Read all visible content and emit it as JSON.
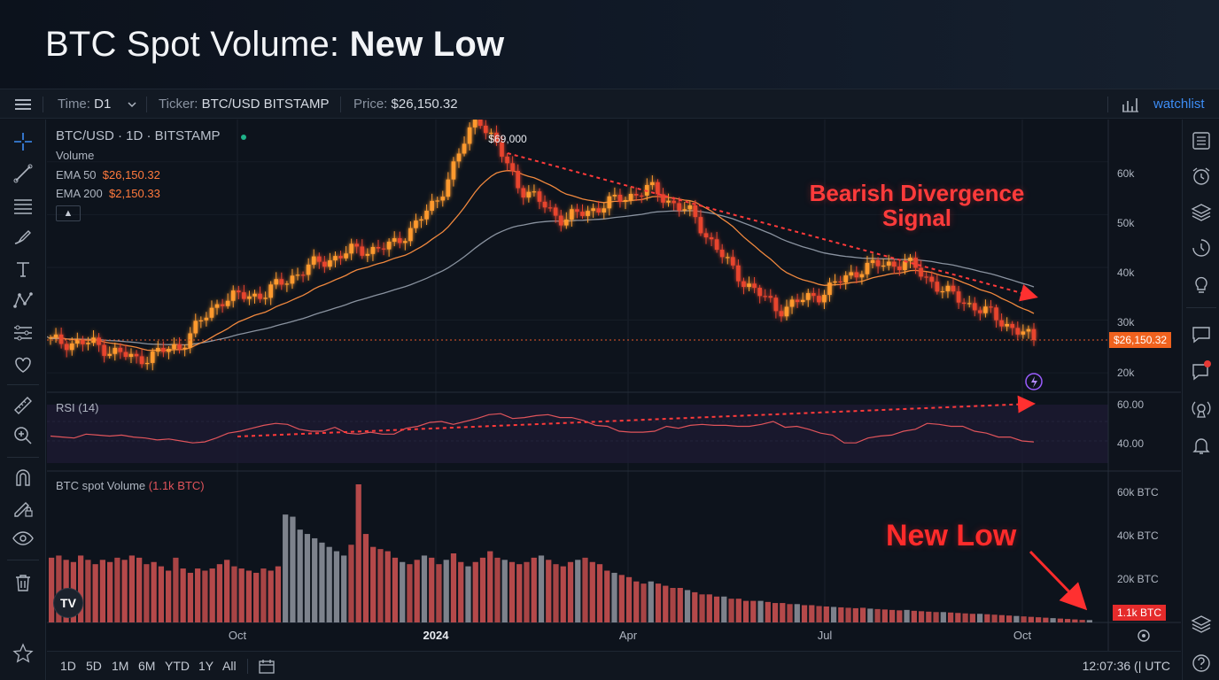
{
  "headline": {
    "prefix": "BTC Spot Volume: ",
    "emph": "New Low"
  },
  "toolbar": {
    "time_label": "Time:",
    "time_value": "D1",
    "ticker_label": "Ticker:",
    "ticker_value": "BTC/USD BITSTAMP",
    "price_label": "Price:",
    "price_value": "$26,150.32",
    "watchlist": "watchlist"
  },
  "legend": {
    "symbol": "BTC/USD · 1D · BITSTAMP",
    "volume": "Volume",
    "ema50_label": "EMA 50",
    "ema50_value": "$26,150.32",
    "ema200_label": "EMA 200",
    "ema200_value": "$2,150.33",
    "rsi_label": "RSI (14)",
    "vol_label": "BTC spot Volume",
    "vol_value": "(1.1k BTC)"
  },
  "annotations": {
    "peak_label": "$69,000",
    "divergence_line1": "Bearish Divergence",
    "divergence_line2": "Signal",
    "new_low": "New Low"
  },
  "badges": {
    "price": "$26,150.32",
    "volume": "1.1k BTC"
  },
  "bottombar": {
    "ranges": [
      "1D",
      "5D",
      "1M",
      "6M",
      "YTD",
      "1Y",
      "All"
    ],
    "clock": "12:07:36 (| UTC"
  },
  "colors": {
    "up": "#ff9a2e",
    "down": "#e8442e",
    "ema50": "#f0883e",
    "ema200": "#8a93a0",
    "accent": "#3d8df5",
    "alert": "#ff2b2b"
  },
  "icons": {
    "left": [
      "crosshair-icon",
      "trend-line-icon",
      "fib-retracement-icon",
      "brush-icon",
      "text-icon",
      "pattern-icon",
      "measure-lines-icon",
      "heart-icon",
      "ruler-icon",
      "zoom-in-icon",
      "magnet-icon",
      "lock-drawing-icon",
      "eye-icon",
      "trash-icon",
      "star-icon"
    ],
    "right": [
      "list-icon",
      "alarm-clock-icon",
      "layers-icon",
      "history-icon",
      "lightbulb-icon",
      "chat-icon",
      "notification-chat-icon",
      "broadcast-icon",
      "bell-icon",
      "stack-icon",
      "help-icon"
    ]
  },
  "chart_data": [
    {
      "type": "candlestick",
      "title": "BTC/USD · 1D · BITSTAMP",
      "x_ticks": [
        "Oct",
        "2024",
        "Apr",
        "Jul",
        "Oct"
      ],
      "y_ticks": [
        "20k",
        "30k",
        "40k",
        "50k",
        "60k"
      ],
      "y_unit": "USD",
      "ylim": [
        17000,
        65000
      ],
      "series": [
        {
          "name": "EMA 50",
          "last": 26150.32
        },
        {
          "name": "EMA 200",
          "last": 2150.33
        }
      ],
      "close_path": [
        [
          "Aug",
          26000
        ],
        [
          "Sep",
          25500
        ],
        [
          "mid-Sep",
          22500
        ],
        [
          "Oct",
          25000
        ],
        [
          "late-Oct",
          34000
        ],
        [
          "Nov",
          35000
        ],
        [
          "Dec",
          40000
        ],
        [
          "Jan",
          43000
        ],
        [
          "late-Jan",
          44000
        ],
        [
          "Feb",
          52000
        ],
        [
          "Mar",
          69000
        ],
        [
          "late-Mar",
          55000
        ],
        [
          "Apr",
          49000
        ],
        [
          "May",
          52000
        ],
        [
          "late-May",
          55000
        ],
        [
          "Jun",
          50000
        ],
        [
          "late-Jun",
          39000
        ],
        [
          "Jul",
          32000
        ],
        [
          "late-Jul",
          35000
        ],
        [
          "Aug",
          40000
        ],
        [
          "late-Aug",
          41000
        ],
        [
          "Sep",
          35000
        ],
        [
          "late-Sep",
          31000
        ],
        [
          "Oct",
          26150
        ]
      ],
      "last_price": 26150.32,
      "peak": 69000
    },
    {
      "type": "line",
      "title": "RSI (14)",
      "y_ticks": [
        "40.00",
        "60.00"
      ],
      "ylim": [
        20,
        80
      ],
      "values": [
        45,
        44,
        43,
        47,
        46,
        45,
        46,
        44,
        43,
        41,
        42,
        40,
        38,
        39,
        43,
        48,
        50,
        53,
        56,
        58,
        57,
        52,
        50,
        50,
        54,
        48,
        47,
        49,
        47,
        47,
        53,
        55,
        59,
        60,
        57,
        60,
        63,
        67,
        68,
        63,
        64,
        66,
        67,
        64,
        64,
        61,
        56,
        55,
        50,
        49,
        49,
        50,
        55,
        53,
        56,
        57,
        56,
        56,
        55,
        55,
        57,
        60,
        54,
        55,
        52,
        48,
        46,
        38,
        38,
        43,
        45,
        46,
        50,
        52,
        58,
        57,
        55,
        55,
        50,
        48,
        44,
        44,
        40,
        39
      ]
    },
    {
      "type": "bar",
      "title": "BTC spot Volume",
      "y_ticks": [
        "20k BTC",
        "40k BTC",
        "60k BTC"
      ],
      "ylim": [
        0,
        64000
      ],
      "x_ticks": [
        "Oct",
        "2024",
        "Apr",
        "Jul",
        "Oct"
      ],
      "values": [
        30000,
        31000,
        29000,
        28000,
        31000,
        29000,
        27000,
        29000,
        28000,
        30000,
        29000,
        31000,
        30000,
        27000,
        28000,
        26000,
        24000,
        30000,
        25000,
        23000,
        25000,
        24000,
        25000,
        27000,
        29000,
        26000,
        25000,
        24000,
        23000,
        25000,
        24000,
        26000,
        50000,
        49000,
        43000,
        41000,
        39000,
        37000,
        35000,
        33000,
        31000,
        36000,
        64000,
        41000,
        35000,
        34000,
        33000,
        30000,
        28000,
        27000,
        29000,
        31000,
        30000,
        27000,
        29000,
        32000,
        28000,
        26000,
        28000,
        30000,
        33000,
        30000,
        29000,
        28000,
        27000,
        28000,
        30000,
        31000,
        29000,
        27000,
        26000,
        28000,
        29000,
        30000,
        28000,
        27000,
        24000,
        23000,
        22000,
        21000,
        19000,
        18000,
        19000,
        18000,
        17000,
        16000,
        16000,
        15000,
        14000,
        13000,
        13000,
        12000,
        12000,
        11000,
        11000,
        10000,
        10000,
        10000,
        9500,
        9000,
        9000,
        8500,
        8500,
        8000,
        8000,
        7600,
        7400,
        7200,
        7000,
        6800,
        6600,
        6800,
        6400,
        6200,
        6000,
        5800,
        5600,
        5800,
        5400,
        5200,
        5000,
        4800,
        4800,
        4600,
        4400,
        4200,
        4000,
        4000,
        3800,
        3600,
        3400,
        3200,
        3000,
        2800,
        2600,
        2400,
        2200,
        2000,
        1800,
        1600,
        1400,
        1200,
        1100
      ],
      "last": 1100,
      "last_label": "1.1k BTC"
    }
  ]
}
